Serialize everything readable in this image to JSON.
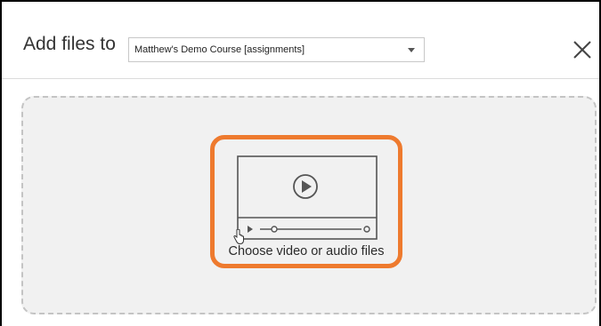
{
  "dialog": {
    "title": "Add files to",
    "course_select": {
      "selected": "Matthew's Demo Course [assignments]"
    },
    "close_icon": "close-icon"
  },
  "dropzone": {
    "choose_label": "Choose video or audio files",
    "icon": "video-player-icon",
    "highlight_color": "#ee7a2e"
  }
}
